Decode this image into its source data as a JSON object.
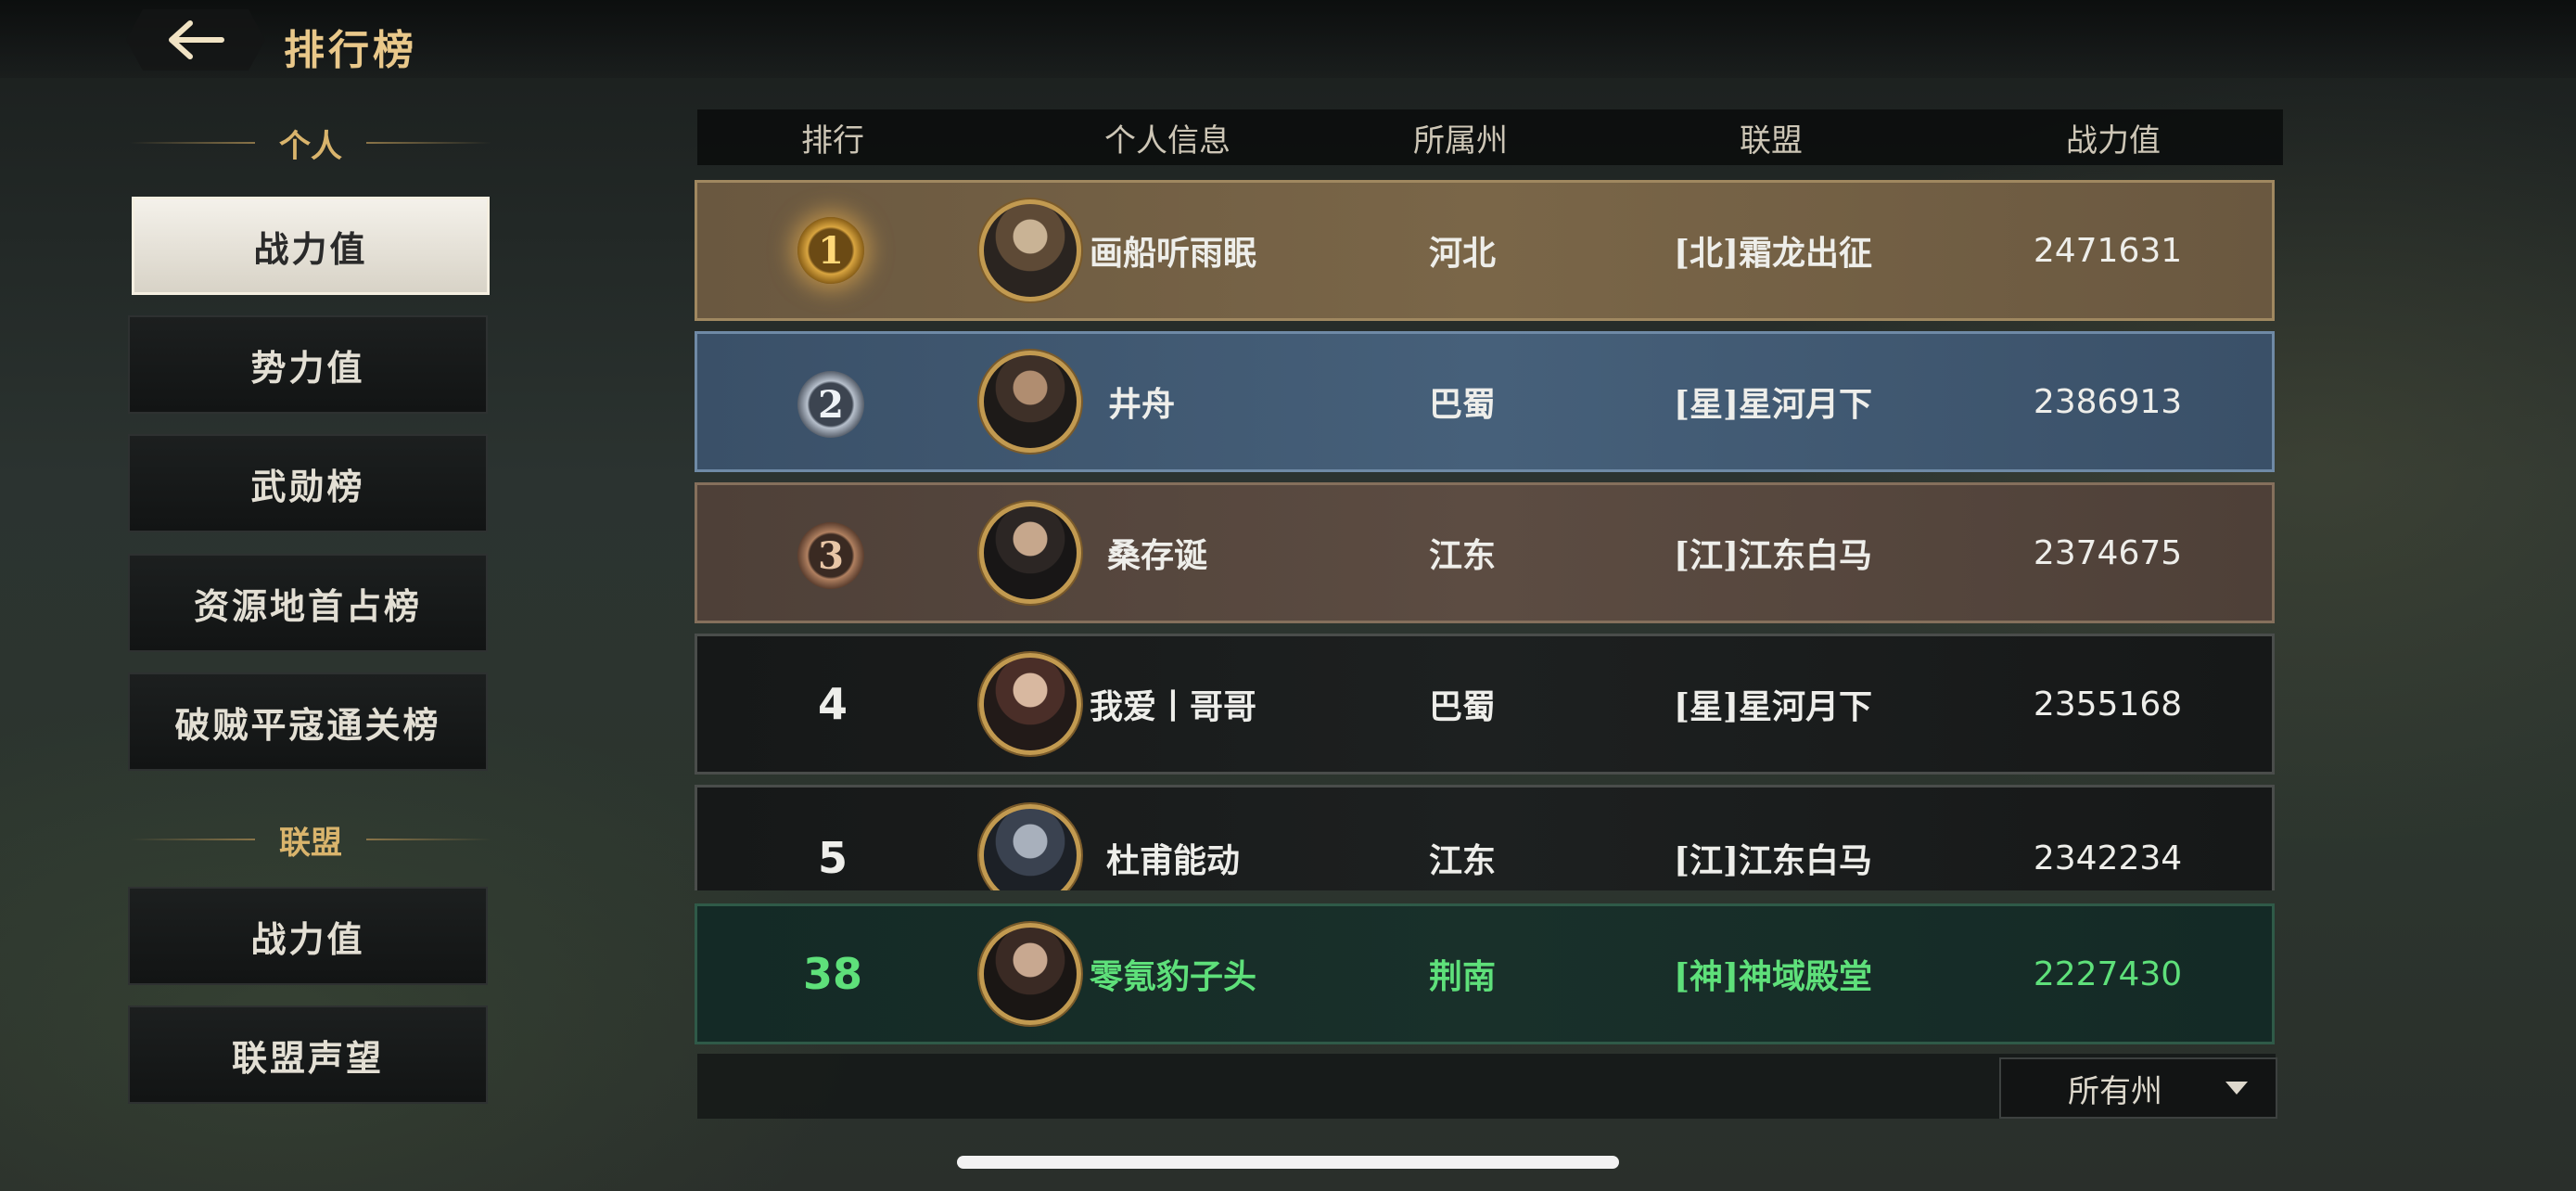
{
  "page_title": "排行榜",
  "sidebar": {
    "personal_header": "个人",
    "personal_items": [
      "战力值",
      "势力值",
      "武勋榜",
      "资源地首占榜",
      "破贼平寇通关榜"
    ],
    "alliance_header": "联盟",
    "alliance_items": [
      "战力值",
      "联盟声望"
    ]
  },
  "table": {
    "columns": [
      "排行",
      "个人信息",
      "所属州",
      "联盟",
      "战力值"
    ],
    "rows": [
      {
        "rank": "1",
        "name": "画船听雨眠",
        "state": "河北",
        "alliance": "[北]霜龙出征",
        "power": "2471631"
      },
      {
        "rank": "2",
        "name": "井舟",
        "state": "巴蜀",
        "alliance": "[星]星河月下",
        "power": "2386913"
      },
      {
        "rank": "3",
        "name": "桑存诞",
        "state": "江东",
        "alliance": "[江]江东白马",
        "power": "2374675"
      },
      {
        "rank": "4",
        "name": "我爱丨哥哥",
        "state": "巴蜀",
        "alliance": "[星]星河月下",
        "power": "2355168"
      },
      {
        "rank": "5",
        "name": "杜甫能动",
        "state": "江东",
        "alliance": "[江]江东白马",
        "power": "2342234"
      }
    ],
    "self_row": {
      "rank": "38",
      "name": "零氪豹子头",
      "state": "荆南",
      "alliance": "[神]神域殿堂",
      "power": "2227430"
    }
  },
  "filter": {
    "selected": "所有州"
  },
  "colors": {
    "accent_gold": "#e9c88a",
    "self_highlight": "#5ee07a",
    "rank1_row": "#7a6648",
    "rank2_row": "#46607a",
    "rank3_row": "#5c4c42"
  }
}
